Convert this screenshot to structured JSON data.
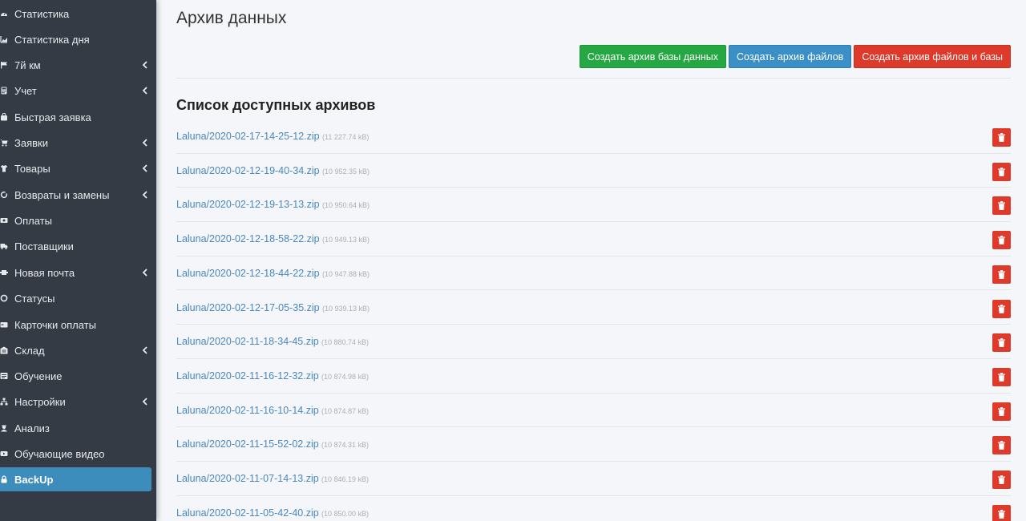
{
  "sidebar": {
    "items": [
      {
        "label": "Статистика",
        "icon": "dashboard-icon",
        "has_children": false
      },
      {
        "label": "Статистика дня",
        "icon": "area-chart-icon",
        "has_children": false
      },
      {
        "label": "7й км",
        "icon": "flag-icon",
        "has_children": true
      },
      {
        "label": "Учет",
        "icon": "calculator-icon",
        "has_children": true
      },
      {
        "label": "Быстрая заявка",
        "icon": "shopping-bag-icon",
        "has_children": false
      },
      {
        "label": "Заявки",
        "icon": "cart-icon",
        "has_children": true
      },
      {
        "label": "Товары",
        "icon": "tshirt-icon",
        "has_children": true
      },
      {
        "label": "Возвраты и замены",
        "icon": "refresh-icon",
        "has_children": true
      },
      {
        "label": "Оплаты",
        "icon": "money-icon",
        "has_children": false
      },
      {
        "label": "Поставщики",
        "icon": "truck-icon",
        "has_children": false
      },
      {
        "label": "Новая почта",
        "icon": "shipping-icon",
        "has_children": true
      },
      {
        "label": "Статусы",
        "icon": "circle-icon",
        "has_children": false
      },
      {
        "label": "Карточки оплаты",
        "icon": "credit-card-icon",
        "has_children": false
      },
      {
        "label": "Склад",
        "icon": "warehouse-icon",
        "has_children": true
      },
      {
        "label": "Обучение",
        "icon": "list-icon",
        "has_children": false
      },
      {
        "label": "Настройки",
        "icon": "sitemap-icon",
        "has_children": true
      },
      {
        "label": "Анализ",
        "icon": "user-secret-icon",
        "has_children": false
      },
      {
        "label": "Обучающие видео",
        "icon": "video-icon",
        "has_children": false
      },
      {
        "label": "BackUp",
        "icon": "lock-icon",
        "has_children": false,
        "active": true
      }
    ]
  },
  "main": {
    "title": "Архив данных",
    "buttons": {
      "create_db": "Создать архив базы данных",
      "create_files": "Создать архив файлов",
      "create_files_db": "Создать архив файлов и базы"
    },
    "section_title": "Список доступных архивов",
    "archives": [
      {
        "name": "Laluna/2020-02-17-14-25-12.zip",
        "size": "(11 227.74 kB)"
      },
      {
        "name": "Laluna/2020-02-12-19-40-34.zip",
        "size": "(10 952.35 kB)"
      },
      {
        "name": "Laluna/2020-02-12-19-13-13.zip",
        "size": "(10 950.64 kB)"
      },
      {
        "name": "Laluna/2020-02-12-18-58-22.zip",
        "size": "(10 949.13 kB)"
      },
      {
        "name": "Laluna/2020-02-12-18-44-22.zip",
        "size": "(10 947.88 kB)"
      },
      {
        "name": "Laluna/2020-02-12-17-05-35.zip",
        "size": "(10 939.13 kB)"
      },
      {
        "name": "Laluna/2020-02-11-18-34-45.zip",
        "size": "(10 880.74 kB)"
      },
      {
        "name": "Laluna/2020-02-11-16-12-32.zip",
        "size": "(10 874.98 kB)"
      },
      {
        "name": "Laluna/2020-02-11-16-10-14.zip",
        "size": "(10 874.87 kB)"
      },
      {
        "name": "Laluna/2020-02-11-15-52-02.zip",
        "size": "(10 874.31 kB)"
      },
      {
        "name": "Laluna/2020-02-11-07-14-13.zip",
        "size": "(10 846.19 kB)"
      },
      {
        "name": "Laluna/2020-02-11-05-42-40.zip",
        "size": "(10 850.00 kB)"
      }
    ]
  },
  "colors": {
    "sidebar_bg": "#353b44",
    "active_item": "#3c8dbc",
    "btn_green": "#25a744",
    "btn_blue": "#3a8fc6",
    "btn_red": "#dd3a2c",
    "link": "#4a87be"
  }
}
